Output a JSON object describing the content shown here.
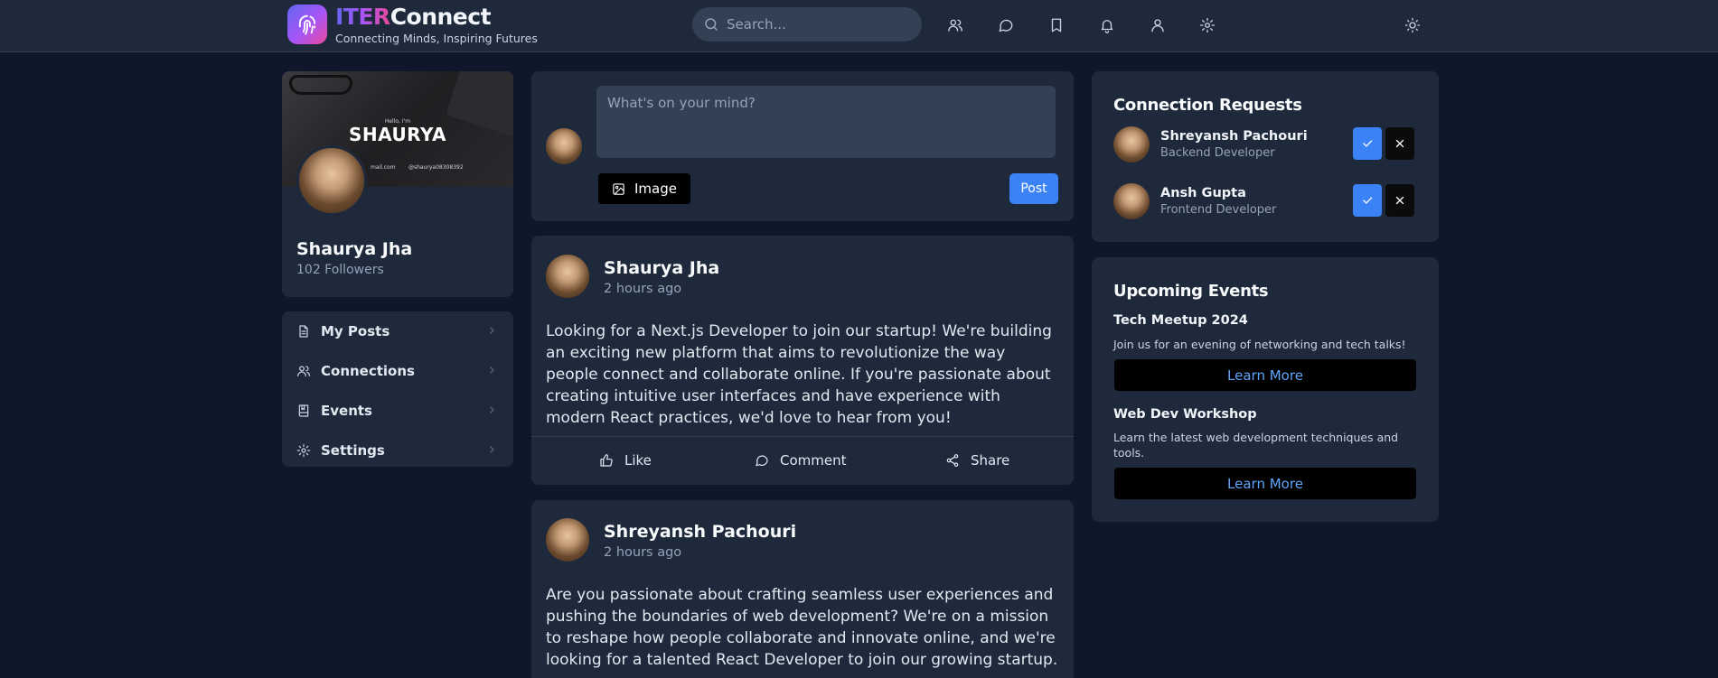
{
  "header": {
    "brand_part1": "ITER",
    "brand_part2": "Connect",
    "tagline": "Connecting Minds, Inspiring Futures",
    "search_placeholder": "Search...",
    "nav_icons": [
      "users-icon",
      "message-icon",
      "bookmark-icon",
      "bell-icon",
      "user-icon",
      "gear-icon",
      "sun-icon"
    ]
  },
  "profile": {
    "cover": {
      "greeting": "Hello, I'm",
      "name": "SHAURYA",
      "email_fragment": "mail.com",
      "handle": "@shaurya08308392"
    },
    "name": "Shaurya Jha",
    "followers": "102 Followers"
  },
  "sidebar_menu": [
    {
      "label": "My Posts",
      "icon": "file-icon"
    },
    {
      "label": "Connections",
      "icon": "users-icon"
    },
    {
      "label": "Events",
      "icon": "book-icon"
    },
    {
      "label": "Settings",
      "icon": "gear-icon"
    }
  ],
  "composer": {
    "placeholder": "What's on your mind?",
    "image_label": "Image",
    "post_label": "Post"
  },
  "posts": [
    {
      "author": "Shaurya Jha",
      "time": "2 hours ago",
      "body": "Looking for a Next.js Developer to join our startup! We're building an exciting new platform that aims to revolutionize the way people connect and collaborate online. If you're passionate about creating intuitive user interfaces and have experience with modern React practices, we'd love to hear from you!"
    },
    {
      "author": "Shreyansh Pachouri",
      "time": "2 hours ago",
      "body": "Are you passionate about crafting seamless user experiences and pushing the boundaries of web development? We're on a mission to reshape how people collaborate and innovate online, and we're looking for a talented React Developer to join our growing startup."
    }
  ],
  "post_actions": {
    "like": "Like",
    "comment": "Comment",
    "share": "Share"
  },
  "connection_requests": {
    "title": "Connection Requests",
    "items": [
      {
        "name": "Shreyansh Pachouri",
        "role": "Backend Developer"
      },
      {
        "name": "Ansh Gupta",
        "role": "Frontend Developer"
      }
    ]
  },
  "events": {
    "title": "Upcoming Events",
    "items": [
      {
        "name": "Tech Meetup 2024",
        "description": "Join us for an evening of networking and tech talks!",
        "button": "Learn More"
      },
      {
        "name": "Web Dev Workshop",
        "description": "Learn the latest web development techniques and tools.",
        "button": "Learn More"
      }
    ]
  },
  "colors": {
    "background": "#0f172a",
    "card": "#1e293b",
    "accent": "#3b82f6",
    "link": "#60a5fa"
  }
}
